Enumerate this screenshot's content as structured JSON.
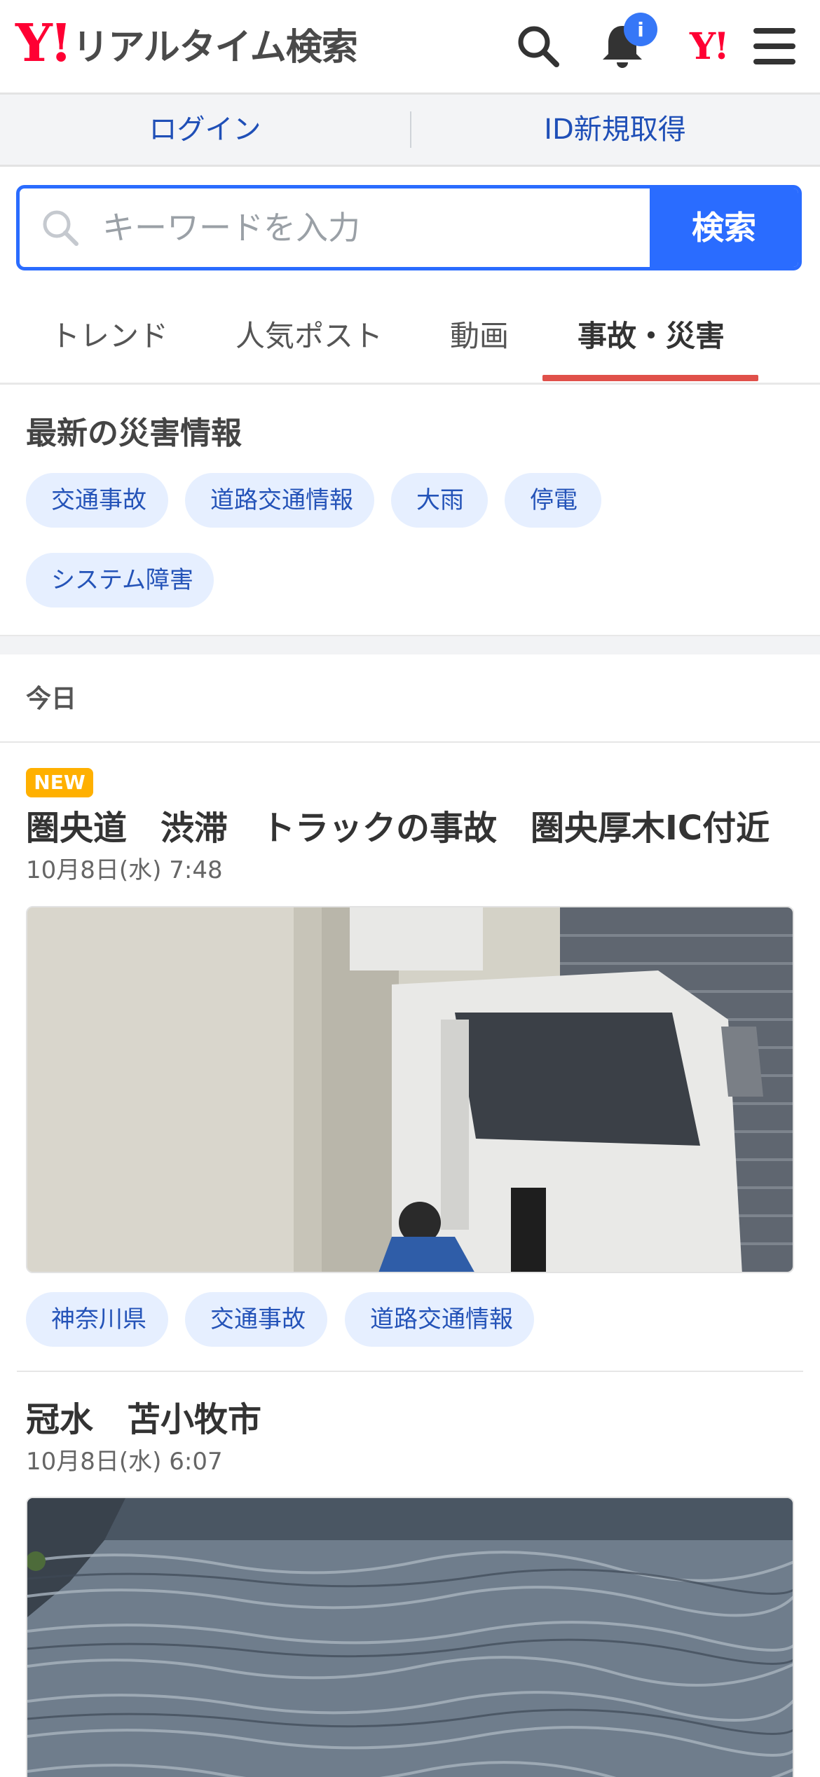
{
  "header": {
    "logo_y": "Y!",
    "logo_text": "リアルタイム検索",
    "notification_badge": "i",
    "yjapan_mark": "Y!",
    "icons": [
      "search-icon",
      "bell-icon",
      "yahoo-japan-icon",
      "hamburger-menu-icon"
    ]
  },
  "auth": {
    "login": "ログイン",
    "signup": "ID新規取得"
  },
  "search": {
    "placeholder": "キーワードを入力",
    "button": "検索"
  },
  "tabs": [
    {
      "label": "トレンド",
      "active": false
    },
    {
      "label": "人気ポスト",
      "active": false
    },
    {
      "label": "動画",
      "active": false
    },
    {
      "label": "事故・災害",
      "active": true
    }
  ],
  "disaster_section": {
    "title": "最新の災害情報",
    "chips": [
      "交通事故",
      "道路交通情報",
      "大雨",
      "停電",
      "システム障害"
    ]
  },
  "timeline": {
    "day_label": "今日"
  },
  "articles": [
    {
      "badge": "NEW",
      "title": "圏央道　渋滞　トラックの事故　圏央厚木IC付近",
      "date": "10月8日(水) 7:48",
      "tags": [
        "神奈川県",
        "交通事故",
        "道路交通情報"
      ]
    },
    {
      "title": "冠水　苫小牧市",
      "date": "10月8日(水) 6:07"
    }
  ],
  "colors": {
    "brand_red": "#ff0033",
    "accent_blue": "#2a6cff",
    "link_blue": "#1f4fb7",
    "chip_bg": "#e6efff",
    "tab_indicator": "#e0504a",
    "new_badge": "#ffb000"
  }
}
